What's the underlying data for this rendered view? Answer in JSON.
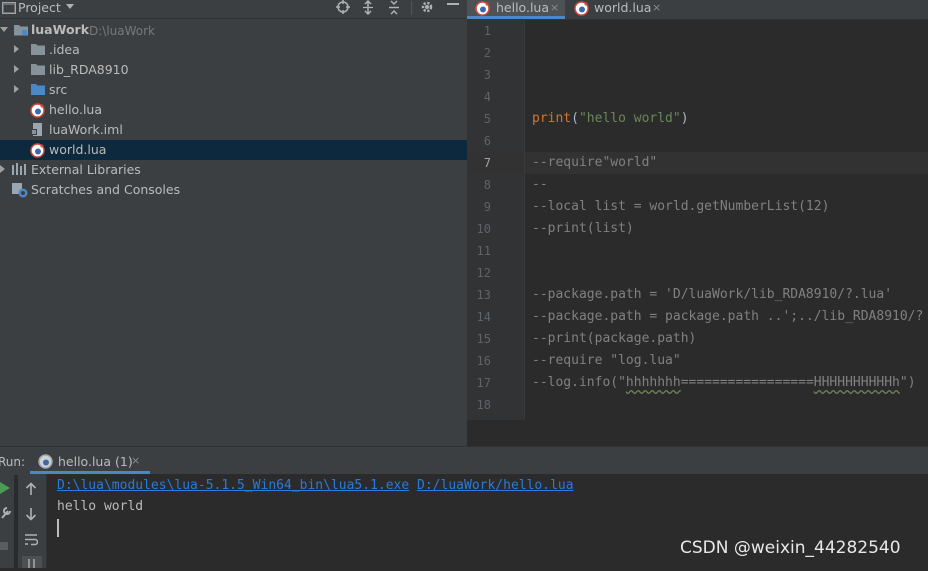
{
  "project": {
    "title": "Project",
    "root_name": "luaWork",
    "root_path": "D:\\luaWork",
    "items": [
      {
        "label": ".idea"
      },
      {
        "label": "lib_RDA8910"
      },
      {
        "label": "src"
      },
      {
        "label": "hello.lua"
      },
      {
        "label": "luaWork.iml"
      },
      {
        "label": "world.lua"
      }
    ],
    "external_libraries": "External Libraries",
    "scratches": "Scratches and Consoles"
  },
  "editor": {
    "tabs": [
      {
        "label": "hello.lua",
        "close": "×"
      },
      {
        "label": "world.lua",
        "close": "×"
      }
    ],
    "line_numbers": [
      "1",
      "2",
      "3",
      "4",
      "5",
      "6",
      "7",
      "8",
      "9",
      "10",
      "11",
      "12",
      "13",
      "14",
      "15",
      "16",
      "17",
      "18"
    ],
    "current_line": 7,
    "code": {
      "l5_func": "print",
      "l5_rest_open": "(",
      "l5_str": "\"hello world\"",
      "l5_rest_close": ")",
      "l7": "--require\"world\"",
      "l8": "--",
      "l9": "--local list = world.getNumberList(12)",
      "l10": "--print(list)",
      "l13": "--package.path = 'D/luaWork/lib_RDA8910/?.lua'",
      "l14": "--package.path = package.path ..';../lib_RDA8910/?",
      "l15": "--print(package.path)",
      "l16": "--require \"log.lua\"",
      "l17_a": "--log.info(\"",
      "l17_b": "hhhhhhh",
      "l17_c": "=================",
      "l17_d": "HHHHHHHHHHh",
      "l17_e": "\")"
    }
  },
  "run": {
    "label": "Run:",
    "tab_label": "hello.lua (1)",
    "tab_close": "×",
    "console": {
      "exe_path": "D:\\lua\\modules\\lua-5.1.5_Win64_bin\\lua5.1.exe",
      "script_path": "D:/luaWork/hello.lua",
      "output": "hello world"
    }
  },
  "watermark": "CSDN @weixin_44282540",
  "colors": {
    "accent": "#4a88c7",
    "selection": "#0d293e",
    "link": "#287bde",
    "keyword": "#cc7832",
    "string": "#6a8759",
    "comment": "#808080"
  }
}
